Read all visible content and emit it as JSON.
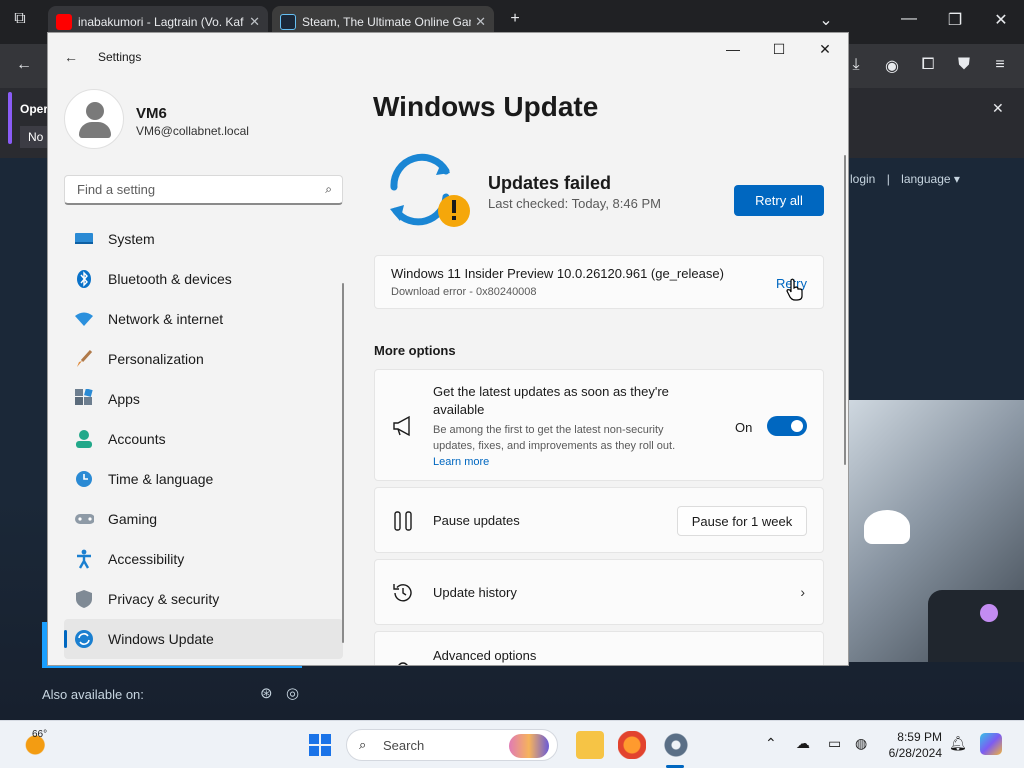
{
  "browser": {
    "tabs": [
      {
        "title": "inabakumori - Lagtrain (Vo. Kaf",
        "close": "✕"
      },
      {
        "title": "Steam, The Ultimate Online Gam",
        "close": "✕"
      }
    ],
    "new_tab": "+",
    "infobar": {
      "text": "Oper",
      "button": "No"
    },
    "steam_links": {
      "login": "login",
      "sep": "|",
      "language": "language ▾"
    },
    "also_available": "Also available on:"
  },
  "settings": {
    "app_title": "Settings",
    "user": {
      "name": "VM6",
      "email": "VM6@collabnet.local"
    },
    "search_placeholder": "Find a setting",
    "nav": [
      {
        "label": "System",
        "icon": "system-icon"
      },
      {
        "label": "Bluetooth & devices",
        "icon": "bluetooth-icon"
      },
      {
        "label": "Network & internet",
        "icon": "network-icon"
      },
      {
        "label": "Personalization",
        "icon": "brush-icon"
      },
      {
        "label": "Apps",
        "icon": "apps-icon"
      },
      {
        "label": "Accounts",
        "icon": "accounts-icon"
      },
      {
        "label": "Time & language",
        "icon": "time-language-icon"
      },
      {
        "label": "Gaming",
        "icon": "gaming-icon"
      },
      {
        "label": "Accessibility",
        "icon": "accessibility-icon"
      },
      {
        "label": "Privacy & security",
        "icon": "shield-icon"
      },
      {
        "label": "Windows Update",
        "icon": "update-icon",
        "active": true
      }
    ],
    "page_title": "Windows Update",
    "status": {
      "title": "Updates failed",
      "last_checked": "Last checked: Today, 8:46 PM",
      "retry_all": "Retry all"
    },
    "update_item": {
      "name": "Windows 11 Insider Preview 10.0.26120.961 (ge_release)",
      "error": "Download error - 0x80240008",
      "retry": "Retry"
    },
    "more_options": "More options",
    "latest": {
      "title_line1": "Get the latest updates as soon as they're",
      "title_line2": "available",
      "desc_line1": "Be among the first to get the latest non-security",
      "desc_line2": "updates, fixes, and improvements as they roll out.",
      "learn_more": "Learn more",
      "toggle_label": "On",
      "toggle_on": true
    },
    "pause": {
      "title": "Pause updates",
      "button": "Pause for 1 week"
    },
    "history": {
      "title": "Update history"
    },
    "advanced": {
      "title": "Advanced options"
    },
    "accent_color": "#0067c0"
  },
  "taskbar": {
    "weather_temp": "66°",
    "search_label": "Search",
    "time": "8:59 PM",
    "date": "6/28/2024"
  }
}
